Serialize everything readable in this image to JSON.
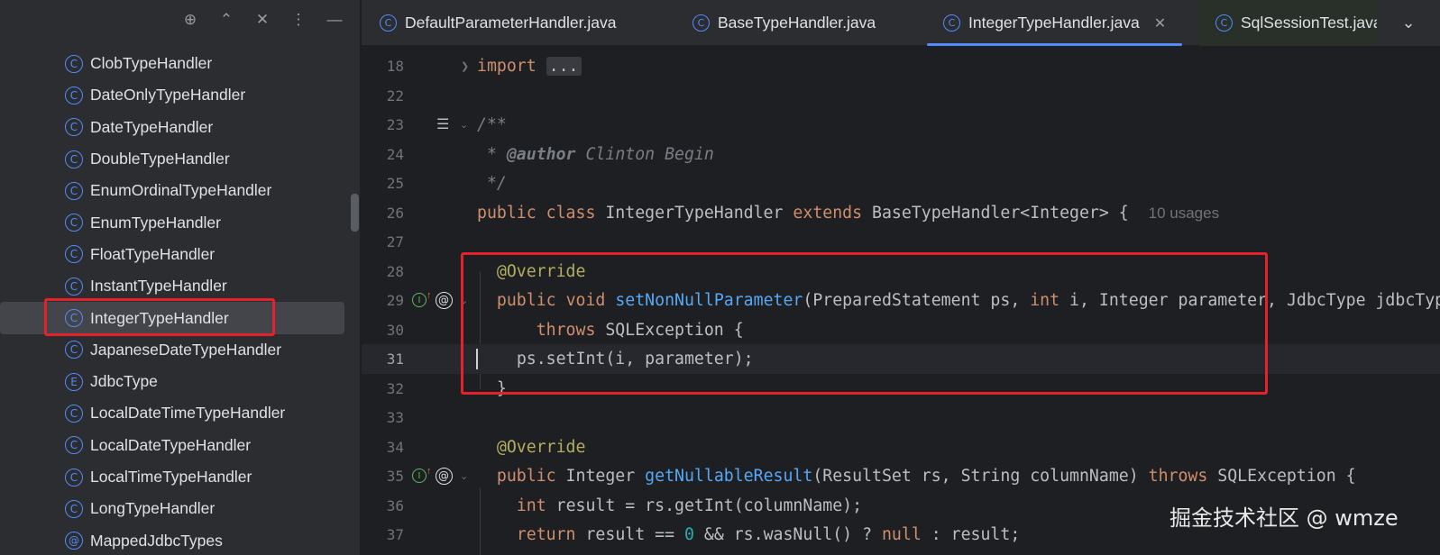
{
  "sidebar": {
    "toolbar": [
      {
        "name": "locate-icon",
        "glyph": "⊕"
      },
      {
        "name": "expand-icon",
        "glyph": "⌃"
      },
      {
        "name": "collapse-icon",
        "glyph": "✕"
      },
      {
        "name": "more-options-icon",
        "glyph": "⋮"
      },
      {
        "name": "hide-icon",
        "glyph": "—"
      }
    ],
    "items": [
      {
        "label": "ClobTypeHandler",
        "kind": "C"
      },
      {
        "label": "DateOnlyTypeHandler",
        "kind": "C"
      },
      {
        "label": "DateTypeHandler",
        "kind": "C"
      },
      {
        "label": "DoubleTypeHandler",
        "kind": "C"
      },
      {
        "label": "EnumOrdinalTypeHandler",
        "kind": "C"
      },
      {
        "label": "EnumTypeHandler",
        "kind": "C"
      },
      {
        "label": "FloatTypeHandler",
        "kind": "C"
      },
      {
        "label": "InstantTypeHandler",
        "kind": "C"
      },
      {
        "label": "IntegerTypeHandler",
        "kind": "C",
        "selected": true
      },
      {
        "label": "JapaneseDateTypeHandler",
        "kind": "C"
      },
      {
        "label": "JdbcType",
        "kind": "E"
      },
      {
        "label": "LocalDateTimeTypeHandler",
        "kind": "C"
      },
      {
        "label": "LocalDateTypeHandler",
        "kind": "C"
      },
      {
        "label": "LocalTimeTypeHandler",
        "kind": "C"
      },
      {
        "label": "LongTypeHandler",
        "kind": "C"
      },
      {
        "label": "MappedJdbcTypes",
        "kind": "@"
      }
    ]
  },
  "tabs": [
    {
      "label": "DefaultParameterHandler.java",
      "kind": "C"
    },
    {
      "label": "BaseTypeHandler.java",
      "kind": "C"
    },
    {
      "label": "IntegerTypeHandler.java",
      "kind": "C",
      "active": true,
      "close": "✕"
    },
    {
      "label": "SqlSessionTest.java",
      "kind": "C"
    }
  ],
  "tab_more_glyph": "⌄",
  "editor": {
    "line_numbers": [
      "18",
      "22",
      "23",
      "24",
      "25",
      "26",
      "27",
      "28",
      "29",
      "30",
      "31",
      "32",
      "33",
      "34",
      "35",
      "36",
      "37"
    ],
    "current_line": "31",
    "usages_hint": "10 usages",
    "colors": {
      "keyword": "#cf8e6d",
      "method": "#56a8f5",
      "annotation": "#b3ae60",
      "comment": "#7a7e85",
      "number": "#2aacb8",
      "highlight_box": "#e5222b"
    }
  },
  "code": {
    "l18_import": "import",
    "l18_folded": "...",
    "l23": "/**",
    "l24_star": " * ",
    "l24_tag": "@author",
    "l24_name": " Clinton Begin",
    "l25": " */",
    "l26_public": "public",
    "l26_class": "class",
    "l26_name": "IntegerTypeHandler",
    "l26_extends": "extends",
    "l26_base": "BaseTypeHandler<Integer> {",
    "l28_ann": "@Override",
    "l29_public": "public",
    "l29_void": "void",
    "l29_method": "setNonNullParameter",
    "l29_p1": "(PreparedStatement ps, ",
    "l29_int": "int",
    "l29_p2": " i, Integer parameter, JdbcType jdbcType)",
    "l30_throws": "throws",
    "l30_rest": " SQLException {",
    "l31": "ps.setInt(i, parameter);",
    "l32": "}",
    "l34_ann": "@Override",
    "l35_public": "public",
    "l35_type": " Integer ",
    "l35_method": "getNullableResult",
    "l35_params": "(ResultSet rs, String columnName) ",
    "l35_throws": "throws",
    "l35_rest": " SQLException {",
    "l36_int": "int",
    "l36_rest": " result = rs.getInt(columnName);",
    "l37_return": "return",
    "l37_a": " result == ",
    "l37_zero": "0",
    "l37_b": " && rs.wasNull() ? ",
    "l37_null": "null",
    "l37_c": " : result;"
  },
  "watermark": "掘金技术社区 @ wmze"
}
